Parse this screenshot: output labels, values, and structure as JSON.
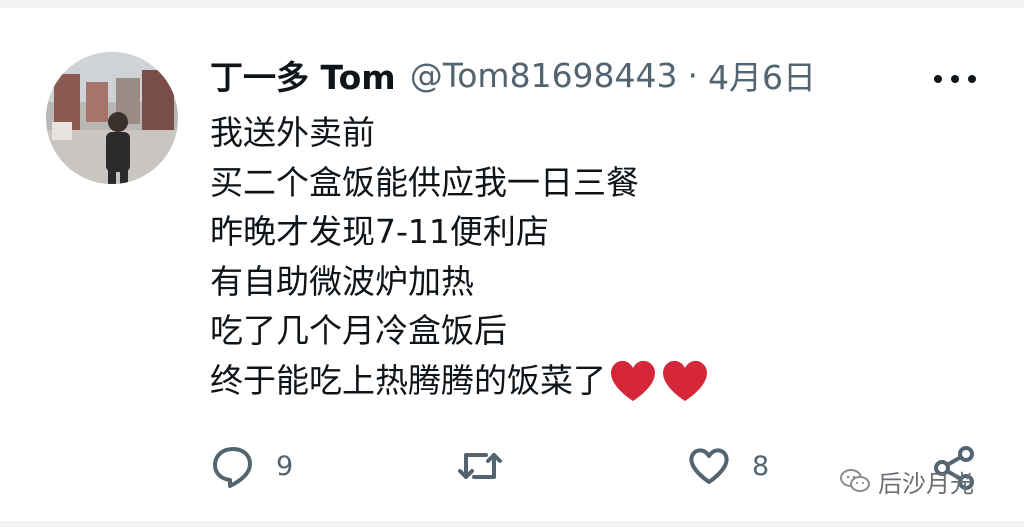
{
  "author": {
    "display_name": "丁一多 Tom",
    "handle": "@Tom81698443",
    "separator": "·",
    "date": "4月6日"
  },
  "tweet": {
    "lines": [
      "我送外卖前",
      "买二个盒饭能供应我一日三餐",
      "昨晚才发现7-11便利店",
      "有自助微波炉加热",
      "吃了几个月冷盒饭后",
      "终于能吃上热腾腾的饭菜了"
    ],
    "trailing_emoji": [
      "red-heart",
      "red-heart"
    ]
  },
  "actions": {
    "reply_count": "9",
    "like_count": "8"
  },
  "watermark": {
    "text": "后沙月光"
  },
  "colors": {
    "text_primary": "#0f1419",
    "text_secondary": "#536471",
    "heart_red": "#d5263a"
  }
}
